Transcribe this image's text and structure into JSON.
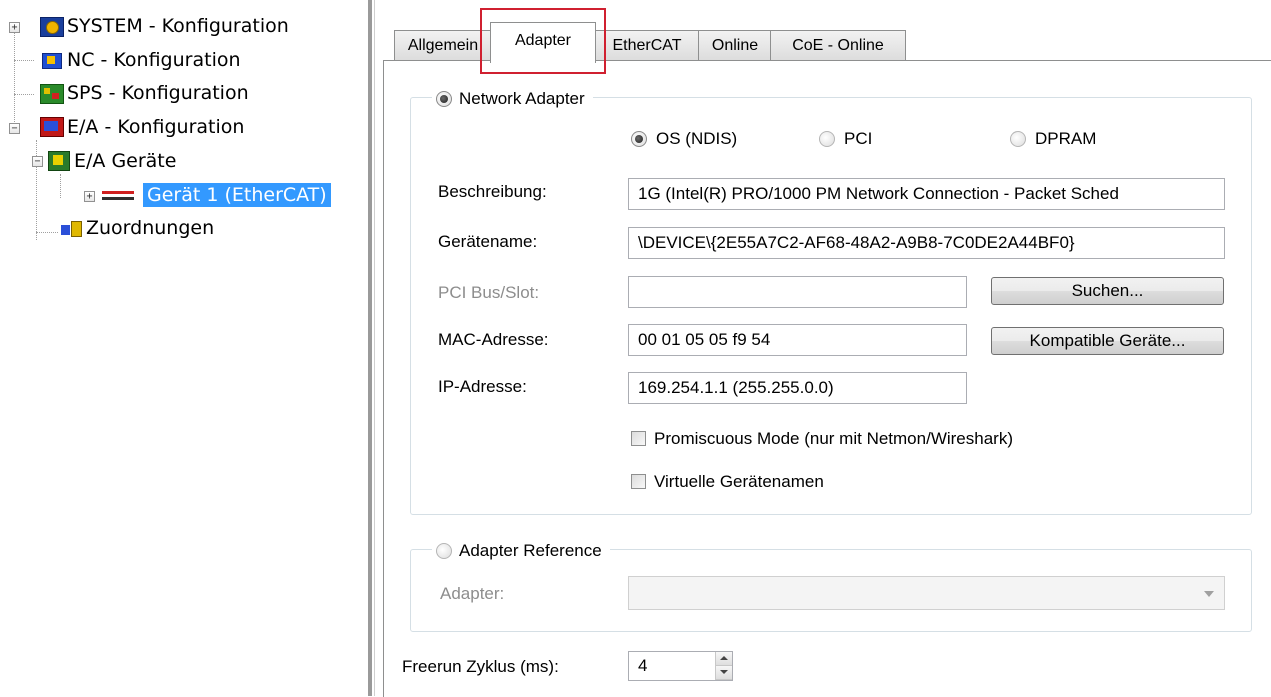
{
  "tree": {
    "items": [
      {
        "label": "SYSTEM - Konfiguration",
        "expander": "+"
      },
      {
        "label": "NC - Konfiguration"
      },
      {
        "label": "SPS - Konfiguration"
      },
      {
        "label": "E/A - Konfiguration",
        "expander": "−"
      },
      {
        "label": "E/A Geräte",
        "expander": "−"
      },
      {
        "label": "Gerät 1 (EtherCAT)",
        "expander": "+",
        "selected": true
      },
      {
        "label": "Zuordnungen"
      }
    ]
  },
  "tabs": [
    "Allgemein",
    "Adapter",
    "EtherCAT",
    "Online",
    "CoE - Online"
  ],
  "active_tab": "Adapter",
  "network_adapter": {
    "legend": "Network Adapter",
    "selected": true,
    "modes": [
      "OS (NDIS)",
      "PCI",
      "DPRAM"
    ],
    "selected_mode": "OS (NDIS)",
    "fields": {
      "beschreibung": {
        "label": "Beschreibung:",
        "value": "1G (Intel(R) PRO/1000 PM Network Connection - Packet Sched"
      },
      "geraetename": {
        "label": "Gerätename:",
        "value": "\\DEVICE\\{2E55A7C2-AF68-48A2-A9B8-7C0DE2A44BF0}"
      },
      "pci_bus_slot": {
        "label": "PCI Bus/Slot:",
        "value": ""
      },
      "mac": {
        "label": "MAC-Adresse:",
        "value": "00 01 05 05 f9 54"
      },
      "ip": {
        "label": "IP-Adresse:",
        "value": "169.254.1.1 (255.255.0.0)"
      }
    },
    "buttons": {
      "suchen": "Suchen...",
      "kompatible": "Kompatible Geräte..."
    },
    "checkboxes": {
      "promiscuous": "Promiscuous Mode (nur mit Netmon/Wireshark)",
      "virtuelle": "Virtuelle Gerätenamen"
    }
  },
  "adapter_reference": {
    "legend": "Adapter Reference",
    "adapter_label": "Adapter:",
    "adapter_value": ""
  },
  "freerun": {
    "label": "Freerun Zyklus (ms):",
    "value": "4"
  },
  "colors": {
    "selection": "#3399ff",
    "highlight_box": "#d02030"
  }
}
